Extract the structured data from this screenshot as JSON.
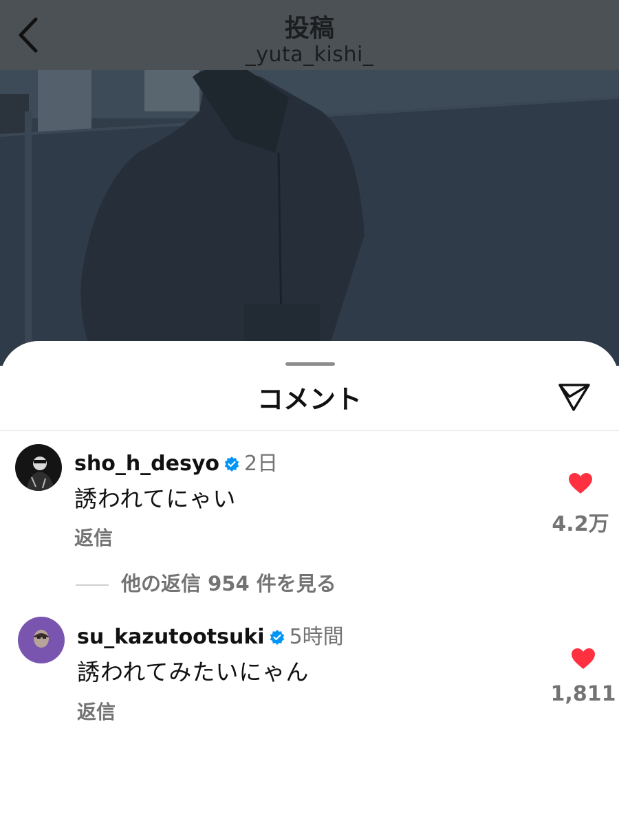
{
  "header": {
    "title": "投稿",
    "subtitle": "_yuta_kishi_"
  },
  "sheet": {
    "title": "コメント"
  },
  "comments": [
    {
      "username": "sho_h_desyo",
      "verified": true,
      "time": "2日",
      "text": "誘われてにゃい",
      "reply_label": "返信",
      "likes": "4.2万",
      "liked": true,
      "more_replies": "他の返信 954 件を見る"
    },
    {
      "username": "su_kazutootsuki",
      "verified": true,
      "time": "5時間",
      "text": "誘われてみたいにゃん",
      "reply_label": "返信",
      "likes": "1,811",
      "liked": true
    }
  ],
  "icons": {
    "back": "chevron-left-icon",
    "share": "send-icon",
    "verified": "verified-badge-icon",
    "like": "heart-icon"
  },
  "colors": {
    "header_bg": "#4c5155",
    "verified_blue": "#0095f6",
    "like_red": "#ff3040",
    "secondary_text": "#737373"
  }
}
